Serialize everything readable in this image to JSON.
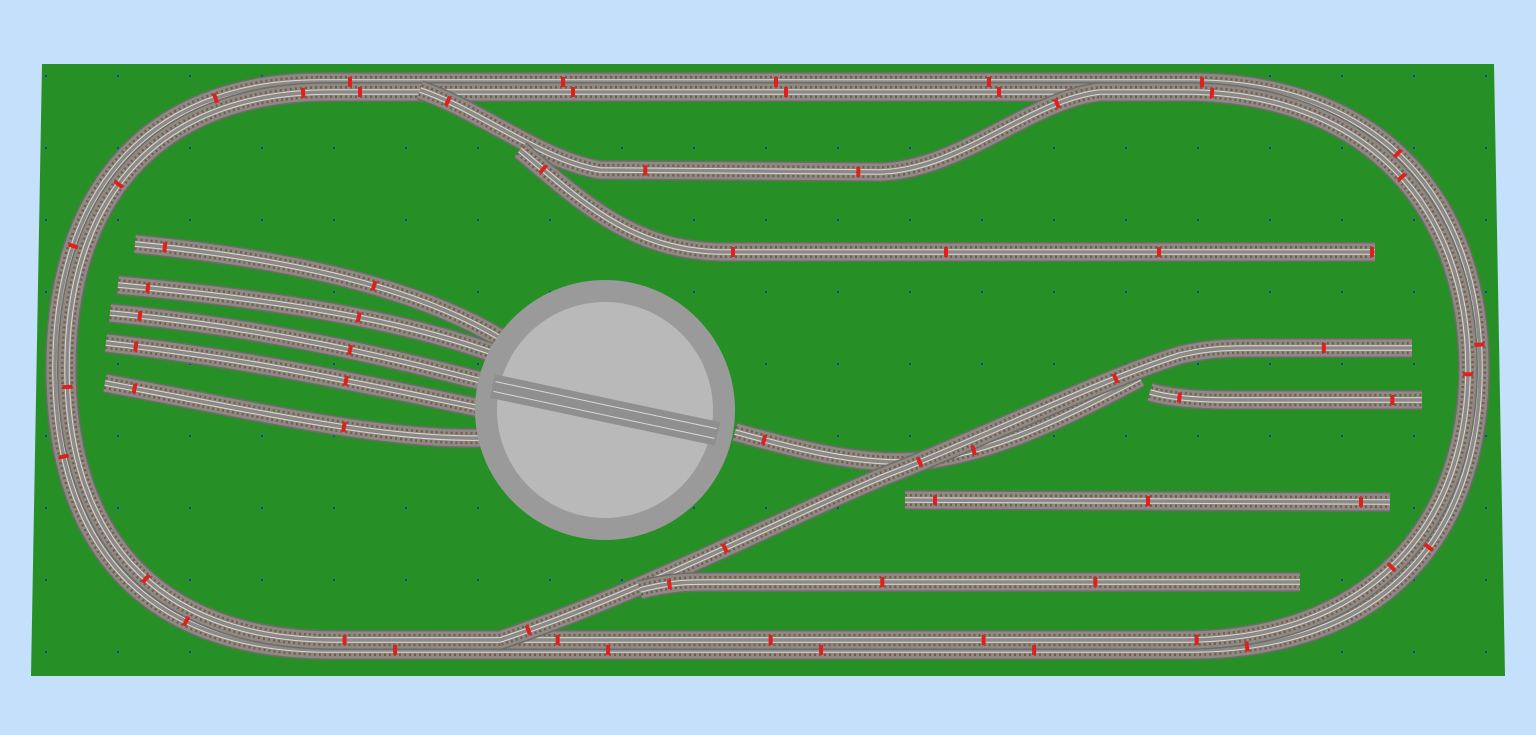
{
  "colors": {
    "background": "#c4e0fb",
    "baseboard": "#269026",
    "baseboard_edge": "#1d7a1d",
    "grid_dot": "#1a3fb0",
    "ballast": "#8d8a86",
    "ballast_dark": "#6e6b68",
    "ties": "#7a5a44",
    "rail": "#d9d9d9",
    "joint": "#e0201c",
    "turntable_ring": "#9a9a9a",
    "turntable_pit": "#b9b9b9",
    "turntable_bridge": "#8f8f8f"
  },
  "layout": {
    "elements": [
      "baseboard",
      "oval-main-line",
      "upper-passing-siding",
      "upper-long-siding",
      "turntable",
      "engine-shed-spurs",
      "right-yard-sidings",
      "diagonal-crossover",
      "bottom-siding"
    ],
    "turntable_spur_count": 5,
    "right_yard_track_count": 4
  }
}
